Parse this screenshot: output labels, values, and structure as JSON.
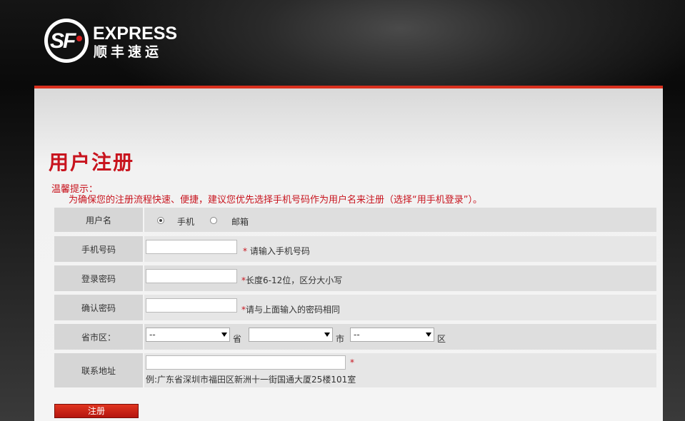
{
  "brand": {
    "logo_mark": "SF",
    "logo_en": "EXPRESS",
    "logo_cn": "顺丰速运"
  },
  "page": {
    "title": "用户注册",
    "tip_label": "温馨提示：",
    "tip_text": "为确保您的注册流程快速、便捷，建议您优先选择手机号码作为用户名来注册（选择“用手机登录”）。"
  },
  "form": {
    "username": {
      "label": "用户名",
      "options": [
        "手机",
        "邮箱"
      ],
      "selected": "手机"
    },
    "phone": {
      "label": "手机号码",
      "value": "",
      "required_mark": "*",
      "hint": "请输入手机号码"
    },
    "password": {
      "label": "登录密码",
      "value": "",
      "required_mark": "*",
      "hint": "长度6-12位，区分大小写"
    },
    "confirm_password": {
      "label": "确认密码",
      "value": "",
      "required_mark": "*",
      "hint": "请与上面输入的密码相同"
    },
    "region": {
      "label": "省市区：",
      "province_value": "--",
      "province_suffix": "省",
      "city_value": "",
      "city_suffix": "市",
      "district_value": "--",
      "district_suffix": "区"
    },
    "address": {
      "label": "联系地址",
      "value": "",
      "required_mark": "*",
      "example": "例:广东省深圳市福田区新洲十一街国通大厦25楼101室"
    },
    "submit_label": "注册"
  },
  "colors": {
    "accent": "#c8141e",
    "header_bg": "#111111",
    "button": "#c8261a"
  }
}
